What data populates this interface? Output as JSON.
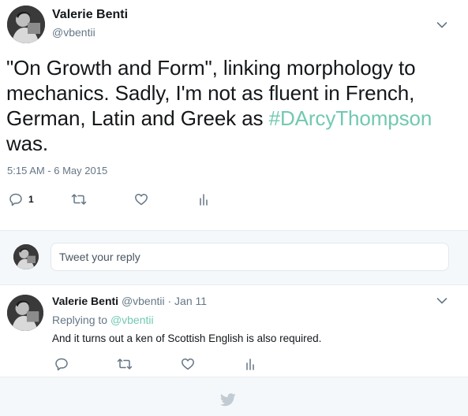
{
  "main_tweet": {
    "display_name": "Valerie Benti",
    "handle": "@vbentii",
    "text_before": "\"On Growth and Form\", linking morphology to mechanics. Sadly, I'm not as fluent in French, German, Latin and Greek as ",
    "hashtag": "#DArcyThompson",
    "text_after": " was.",
    "timestamp": "5:15 AM - 6 May 2015",
    "reply_count": "1",
    "icons": [
      "reply-icon",
      "retweet-icon",
      "like-icon",
      "analytics-icon",
      "chevron-down-icon"
    ]
  },
  "reply_box": {
    "placeholder": "Tweet your reply"
  },
  "reply_tweet": {
    "display_name": "Valerie Benti",
    "meta": "@vbentii · Jan 11",
    "replying_label": "Replying to",
    "replying_to": "@vbentii",
    "text": "And it turns out a ken of Scottish English is also required."
  },
  "footer": {
    "icon": "twitter-bird-icon"
  },
  "colors": {
    "hashtag": "#71c9b1",
    "secondary_text": "#657786",
    "divider": "#e6ecf0",
    "background_alt": "#f5f8fa"
  }
}
